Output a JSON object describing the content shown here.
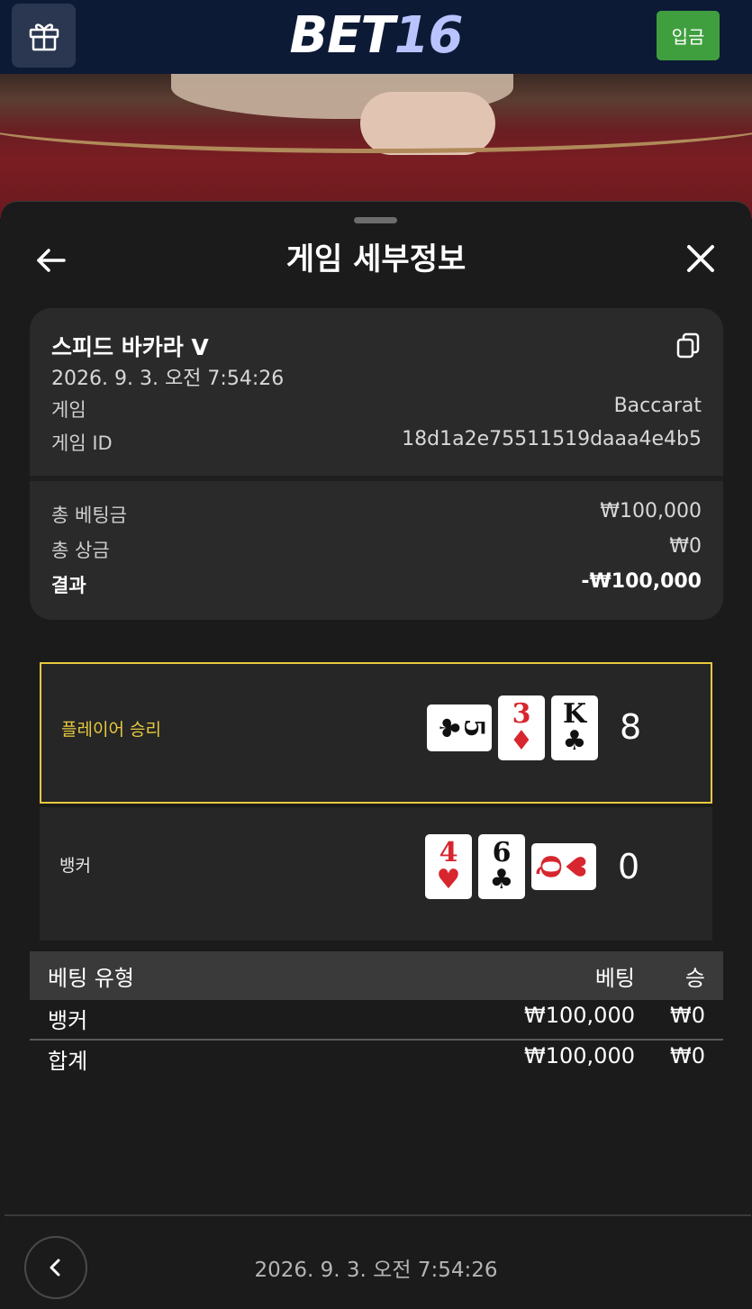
{
  "header": {
    "logo_part1": "BET",
    "logo_part2": "16",
    "deposit_label": "입금",
    "icons": {
      "gift": "gift-icon"
    }
  },
  "sheet": {
    "title": "게임 세부정보",
    "icons": {
      "back": "arrow-left-icon",
      "close": "close-icon",
      "copy": "copy-icon"
    }
  },
  "summary": {
    "game_name": "스피드 바카라 V",
    "timestamp": "2026. 9. 3. 오전 7:54:26",
    "game_label": "게임",
    "game_value": "Baccarat",
    "game_id_label": "게임 ID",
    "game_id_value": "18d1a2e75511519daaa4e4b5",
    "total_bet_label": "총 베팅금",
    "total_bet_value": "₩100,000",
    "total_win_label": "총 상금",
    "total_win_value": "₩0",
    "result_label": "결과",
    "result_value": "-₩100,000"
  },
  "hands": {
    "player": {
      "label": "플레이어 승리",
      "score": "8",
      "cards": [
        {
          "rank": "5",
          "suit": "♣",
          "color": "black",
          "orientation": "sideways"
        },
        {
          "rank": "3",
          "suit": "♦",
          "color": "red",
          "orientation": "upright"
        },
        {
          "rank": "K",
          "suit": "♣",
          "color": "black",
          "orientation": "upright"
        }
      ]
    },
    "banker": {
      "label": "뱅커",
      "score": "0",
      "cards": [
        {
          "rank": "4",
          "suit": "♥",
          "color": "red",
          "orientation": "upright"
        },
        {
          "rank": "6",
          "suit": "♣",
          "color": "black",
          "orientation": "upright"
        },
        {
          "rank": "Q",
          "suit": "♥",
          "color": "red",
          "orientation": "sideways"
        }
      ]
    }
  },
  "bets": {
    "headers": {
      "type": "베팅 유형",
      "bet": "베팅",
      "win": "승"
    },
    "rows": [
      {
        "type": "뱅커",
        "bet": "₩100,000",
        "win": "₩0"
      }
    ],
    "total": {
      "type": "합계",
      "bet": "₩100,000",
      "win": "₩0"
    }
  },
  "footer": {
    "timestamp": "2026. 9. 3. 오전 7:54:26",
    "icons": {
      "prev": "chevron-left-icon"
    }
  },
  "colors": {
    "accent_gold": "#e8c940",
    "deposit_green": "#3f9f3f",
    "header_navy": "#0d1a36",
    "card_red": "#d7262e"
  }
}
